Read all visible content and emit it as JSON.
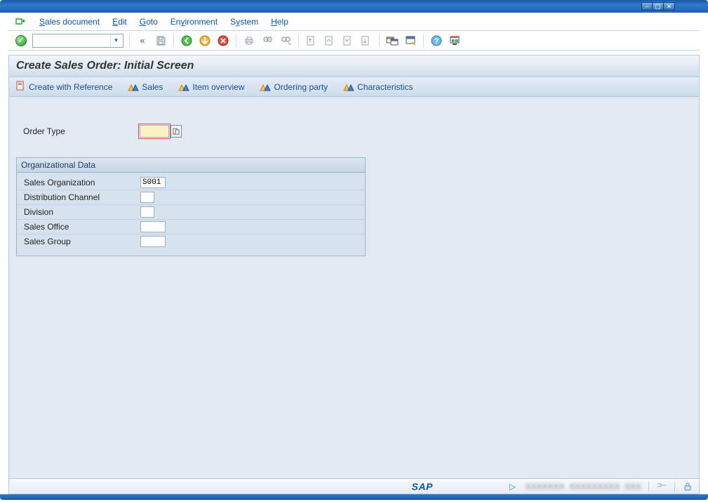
{
  "menubar": {
    "items": [
      {
        "label": "Sales document",
        "ul": "S"
      },
      {
        "label": "Edit",
        "ul": "E"
      },
      {
        "label": "Goto",
        "ul": "G"
      },
      {
        "label": "Environment",
        "ul": "E"
      },
      {
        "label": "System",
        "ul": "S"
      },
      {
        "label": "Help",
        "ul": "H"
      }
    ]
  },
  "page": {
    "title": "Create Sales Order: Initial Screen"
  },
  "app_toolbar": {
    "create_ref": "Create with Reference",
    "sales": "Sales",
    "item_overview": "Item overview",
    "ordering_party": "Ordering party",
    "characteristics": "Characteristics"
  },
  "fields": {
    "order_type_label": "Order Type",
    "order_type_value": ""
  },
  "org_data": {
    "header": "Organizational Data",
    "sales_org_label": "Sales Organization",
    "sales_org_value": "S001",
    "dist_channel_label": "Distribution Channel",
    "dist_channel_value": "",
    "division_label": "Division",
    "division_value": "",
    "sales_office_label": "Sales Office",
    "sales_office_value": "",
    "sales_group_label": "Sales Group",
    "sales_group_value": ""
  },
  "status": {
    "sap": "SAP"
  }
}
